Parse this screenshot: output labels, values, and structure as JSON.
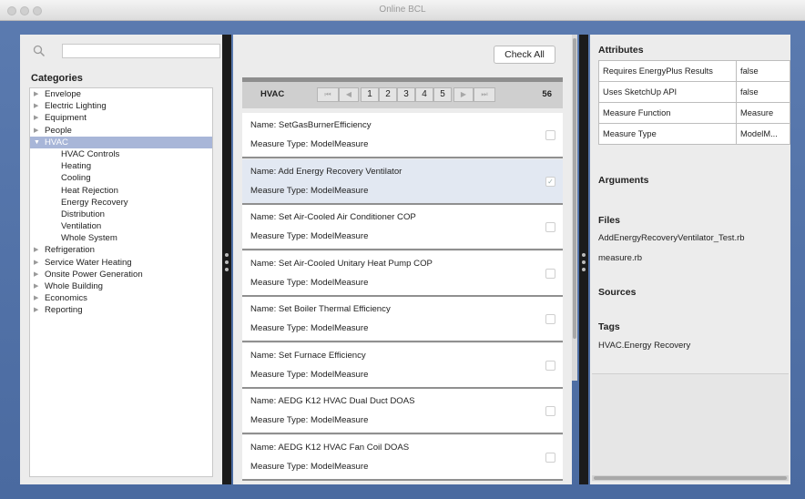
{
  "window": {
    "title": "Online BCL"
  },
  "search": {
    "placeholder": ""
  },
  "categories": {
    "title": "Categories",
    "items": [
      {
        "label": "Envelope",
        "level": 0
      },
      {
        "label": "Electric Lighting",
        "level": 0
      },
      {
        "label": "Equipment",
        "level": 0
      },
      {
        "label": "People",
        "level": 0
      },
      {
        "label": "HVAC",
        "level": 0,
        "expanded": true,
        "selected": true
      },
      {
        "label": "HVAC Controls",
        "level": 1
      },
      {
        "label": "Heating",
        "level": 1
      },
      {
        "label": "Cooling",
        "level": 1
      },
      {
        "label": "Heat Rejection",
        "level": 1
      },
      {
        "label": "Energy Recovery",
        "level": 1
      },
      {
        "label": "Distribution",
        "level": 1
      },
      {
        "label": "Ventilation",
        "level": 1
      },
      {
        "label": "Whole System",
        "level": 1
      },
      {
        "label": "Refrigeration",
        "level": 0
      },
      {
        "label": "Service Water Heating",
        "level": 0
      },
      {
        "label": "Onsite Power Generation",
        "level": 0
      },
      {
        "label": "Whole Building",
        "level": 0
      },
      {
        "label": "Economics",
        "level": 0
      },
      {
        "label": "Reporting",
        "level": 0
      }
    ]
  },
  "toolbar": {
    "check_all": "Check All"
  },
  "pager": {
    "category": "HVAC",
    "first": "⏮",
    "prev": "◀",
    "pages": [
      "1",
      "2",
      "3",
      "4",
      "5"
    ],
    "next": "▶",
    "last": "⏭",
    "total": "56"
  },
  "measures": [
    {
      "name": "Name: SetGasBurnerEfficiency",
      "type": "Measure Type: ModelMeasure",
      "checked": false,
      "selected": false
    },
    {
      "name": "Name: Add Energy Recovery Ventilator",
      "type": "Measure Type: ModelMeasure",
      "checked": true,
      "selected": true
    },
    {
      "name": "Name: Set Air-Cooled Air Conditioner COP",
      "type": "Measure Type: ModelMeasure",
      "checked": false,
      "selected": false
    },
    {
      "name": "Name: Set Air-Cooled Unitary Heat Pump COP",
      "type": "Measure Type: ModelMeasure",
      "checked": false,
      "selected": false
    },
    {
      "name": "Name: Set Boiler Thermal Efficiency",
      "type": "Measure Type: ModelMeasure",
      "checked": false,
      "selected": false
    },
    {
      "name": "Name: Set Furnace Efficiency",
      "type": "Measure Type: ModelMeasure",
      "checked": false,
      "selected": false
    },
    {
      "name": "Name: AEDG K12 HVAC Dual Duct DOAS",
      "type": "Measure Type: ModelMeasure",
      "checked": false,
      "selected": false
    },
    {
      "name": "Name: AEDG K12 HVAC Fan Coil DOAS",
      "type": "Measure Type: ModelMeasure",
      "checked": false,
      "selected": false
    }
  ],
  "details": {
    "attributes_title": "Attributes",
    "attributes": [
      {
        "key": "Requires EnergyPlus Results",
        "value": "false"
      },
      {
        "key": "Uses SketchUp API",
        "value": "false"
      },
      {
        "key": "Measure Function",
        "value": "Measure"
      },
      {
        "key": "Measure Type",
        "value": "ModelM..."
      }
    ],
    "arguments_title": "Arguments",
    "files_title": "Files",
    "files": [
      "AddEnergyRecoveryVentilator_Test.rb",
      "measure.rb"
    ],
    "sources_title": "Sources",
    "tags_title": "Tags",
    "tags": [
      "HVAC.Energy Recovery"
    ]
  }
}
